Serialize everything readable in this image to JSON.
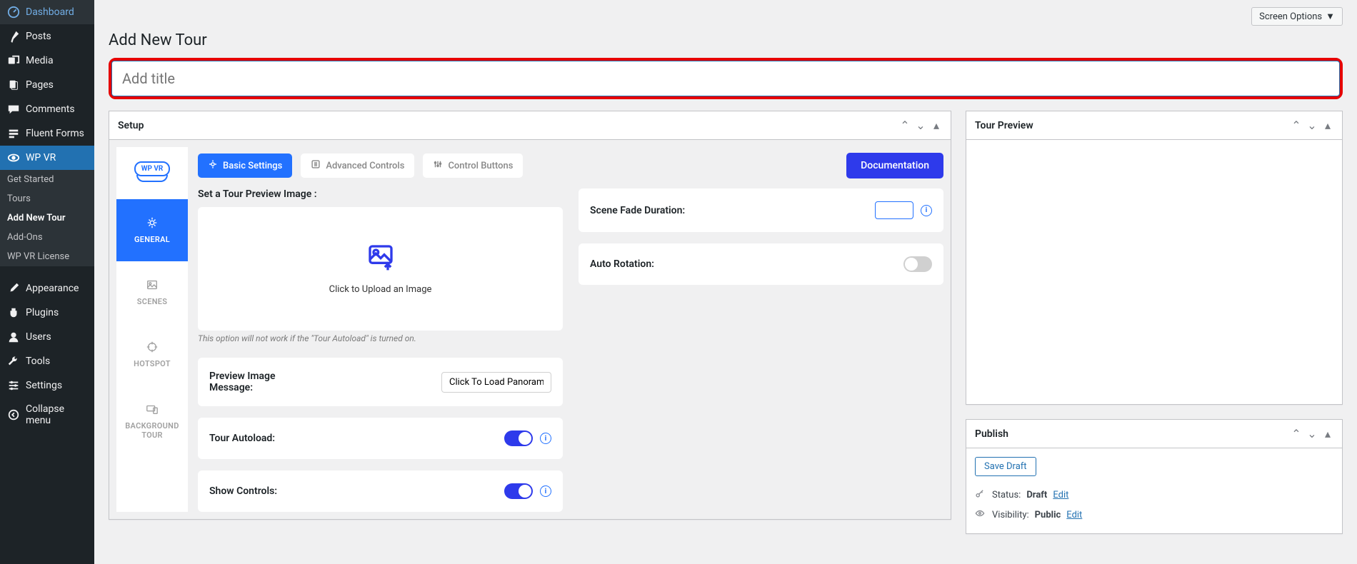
{
  "sidebar": {
    "items": [
      {
        "label": "Dashboard",
        "icon": "dashboard"
      },
      {
        "label": "Posts",
        "icon": "pin"
      },
      {
        "label": "Media",
        "icon": "media"
      },
      {
        "label": "Pages",
        "icon": "pages"
      },
      {
        "label": "Comments",
        "icon": "comments"
      },
      {
        "label": "Fluent Forms",
        "icon": "forms"
      },
      {
        "label": "WP VR",
        "icon": "wpvr"
      },
      {
        "label": "Appearance",
        "icon": "brush"
      },
      {
        "label": "Plugins",
        "icon": "plug"
      },
      {
        "label": "Users",
        "icon": "user"
      },
      {
        "label": "Tools",
        "icon": "wrench"
      },
      {
        "label": "Settings",
        "icon": "sliders"
      },
      {
        "label": "Collapse menu",
        "icon": "collapse"
      }
    ],
    "submenu": [
      {
        "label": "Get Started"
      },
      {
        "label": "Tours"
      },
      {
        "label": "Add New Tour"
      },
      {
        "label": "Add-Ons"
      },
      {
        "label": "WP VR License"
      }
    ]
  },
  "screen_options": "Screen Options",
  "page_title": "Add New Tour",
  "title_placeholder": "Add title",
  "setup": {
    "title": "Setup",
    "logo": "WP VR",
    "vtabs": [
      {
        "label": "GENERAL"
      },
      {
        "label": "SCENES"
      },
      {
        "label": "HOTSPOT"
      },
      {
        "label": "BACKGROUND TOUR"
      }
    ],
    "top_tabs": {
      "basic": "Basic Settings",
      "advanced": "Advanced Controls",
      "buttons": "Control Buttons"
    },
    "documentation": "Documentation",
    "preview_label": "Set a Tour Preview Image :",
    "upload_text": "Click to Upload an Image",
    "hint": "This option will not work if the \"Tour Autoload\" is turned on.",
    "preview_msg_label": "Preview Image Message:",
    "preview_msg_value": "Click To Load Panoram",
    "autoload_label": "Tour Autoload:",
    "controls_label": "Show Controls:",
    "fade_label": "Scene Fade Duration:",
    "rotation_label": "Auto Rotation:"
  },
  "preview": {
    "title": "Tour Preview"
  },
  "publish": {
    "title": "Publish",
    "save_draft": "Save Draft",
    "status_label": "Status:",
    "status_value": "Draft",
    "visibility_label": "Visibility:",
    "visibility_value": "Public",
    "edit": "Edit"
  }
}
